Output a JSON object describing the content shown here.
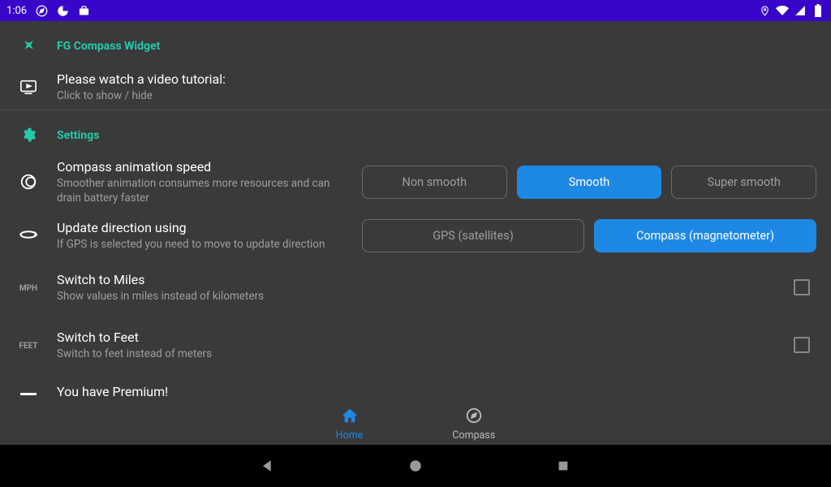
{
  "status": {
    "time": "1:06"
  },
  "header": {
    "title": "FG Compass Widget"
  },
  "tutorial": {
    "title": "Please watch a video tutorial:",
    "sub": "Click to show / hide"
  },
  "settings": {
    "header": "Settings",
    "anim": {
      "title": "Compass animation speed",
      "sub": "Smoother animation consumes more resources and can drain battery faster",
      "options": [
        "Non smooth",
        "Smooth",
        "Super smooth"
      ],
      "selected": 1
    },
    "direction": {
      "title": "Update direction using",
      "sub": "If GPS is selected you need to move to update direction",
      "options": [
        "GPS (satellites)",
        "Compass (magnetometer)"
      ],
      "selected": 1
    },
    "miles": {
      "title": "Switch to Miles",
      "sub": "Show values in miles instead of kilometers",
      "icon": "MPH"
    },
    "feet": {
      "title": "Switch to Feet",
      "sub": "Switch to feet instead of meters",
      "icon": "FEET"
    },
    "premium": {
      "title": "You have Premium!"
    }
  },
  "tabs": {
    "home": "Home",
    "compass": "Compass"
  }
}
